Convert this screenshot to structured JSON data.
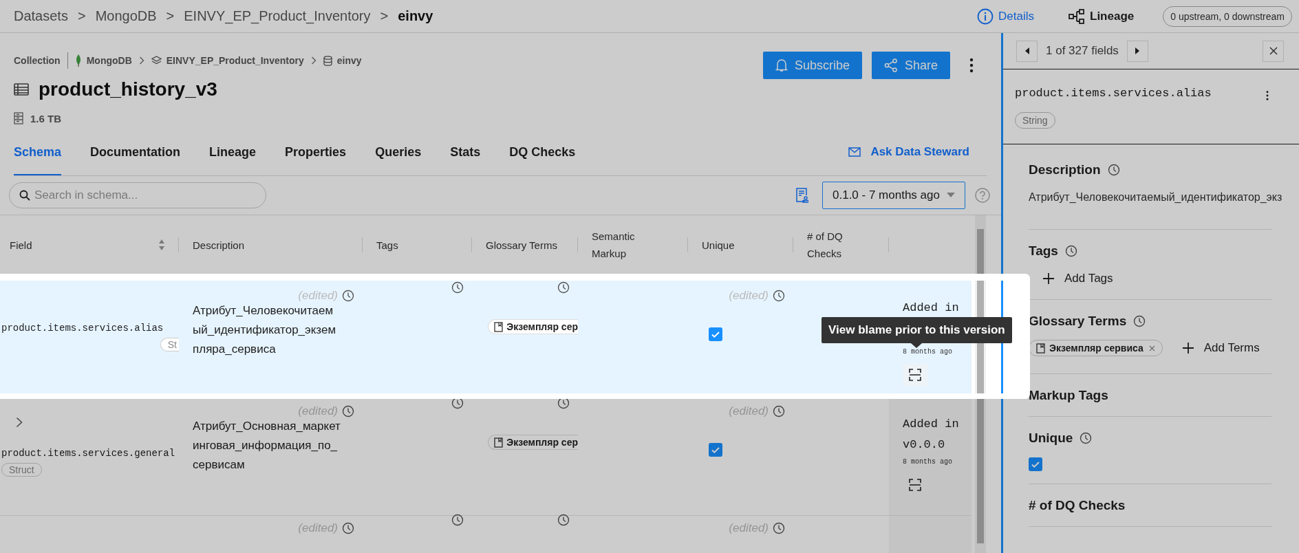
{
  "breadcrumb": {
    "separator": ">",
    "items": [
      {
        "label": "Datasets",
        "current": false
      },
      {
        "label": "MongoDB",
        "current": false
      },
      {
        "label": "EINVY_EP_Product_Inventory",
        "current": false
      },
      {
        "label": "einvy",
        "current": true
      }
    ]
  },
  "view_switch": [
    {
      "label": "Details",
      "kind": "details",
      "selected": true
    },
    {
      "label": "Lineage",
      "kind": "lineage",
      "selected": false
    }
  ],
  "lineage_count": "0 upstream, 0 downstream",
  "entity": {
    "type_label": "Collection",
    "path": [
      {
        "label": "MongoDB",
        "kind": "platform"
      },
      {
        "label": "EINVY_EP_Product_Inventory",
        "kind": "container"
      },
      {
        "label": "einvy",
        "kind": "database"
      }
    ],
    "title": "product_history_v3",
    "size": "1.6 TB"
  },
  "actions": [
    {
      "label": "Subscribe",
      "kind": "subscribe"
    },
    {
      "label": "Share",
      "kind": "share"
    }
  ],
  "tabs": [
    {
      "label": "Schema",
      "selected": true
    },
    {
      "label": "Documentation",
      "selected": false
    },
    {
      "label": "Lineage",
      "selected": false
    },
    {
      "label": "Properties",
      "selected": false
    },
    {
      "label": "Queries",
      "selected": false
    },
    {
      "label": "Stats",
      "selected": false
    },
    {
      "label": "DQ Checks",
      "selected": false
    }
  ],
  "ask_steward": "Ask Data Steward",
  "search": {
    "placeholder": "Search in schema..."
  },
  "version_select": {
    "value": "0.1.0 - 7 months ago"
  },
  "table": {
    "columns": [
      "Field",
      "Description",
      "Tags",
      "Glossary Terms",
      "Semantic Markup",
      "Unique",
      "# of DQ Checks"
    ],
    "rows": [
      {
        "highlighted": true,
        "expandable": false,
        "field": "product.items.services.alias",
        "type": "St",
        "description_edited": "(edited)",
        "description": "Атрибут_Человекочитаемый_идентификатор_экземпляра_сервиса",
        "glossary_term": "Экземпляр сер",
        "unique_edited": "(edited)",
        "unique": true,
        "added_label": "Added in",
        "added_ago": "8 months ago"
      },
      {
        "highlighted": false,
        "expandable": true,
        "field": "product.items.services.general",
        "type": "Struct",
        "description_edited": "(edited)",
        "description": "Атрибут_Основная_маркетинговая_информация_по_сервисам",
        "glossary_term": "Экземпляр сер",
        "unique_edited": "(edited)",
        "unique": true,
        "added_label": "Added in",
        "added_version": "v0.0.0",
        "added_ago": "8 months ago"
      },
      {
        "highlighted": false,
        "expandable": false,
        "description_edited": "(edited)",
        "unique_edited": "(edited)"
      }
    ]
  },
  "tooltip": {
    "text": "View blame prior to this version"
  },
  "field_panel": {
    "counter": "1 of 327 fields",
    "field": "product.items.services.alias",
    "type": "String",
    "sections": [
      {
        "kind": "description",
        "title": "Description",
        "history": true,
        "text": "Атрибут_Человекочитаемый_идентификатор_экз"
      },
      {
        "kind": "tags",
        "title": "Tags",
        "history": true,
        "add_label": "Add Tags"
      },
      {
        "kind": "terms",
        "title": "Glossary Terms",
        "history": true,
        "terms": [
          "Экземпляр сервиса"
        ],
        "add_label": "Add Terms"
      },
      {
        "kind": "markup",
        "title": "Markup Tags",
        "history": false
      },
      {
        "kind": "unique",
        "title": "Unique",
        "history": true,
        "checked": true
      },
      {
        "kind": "dq",
        "title": "# of DQ Checks",
        "history": false
      }
    ]
  }
}
